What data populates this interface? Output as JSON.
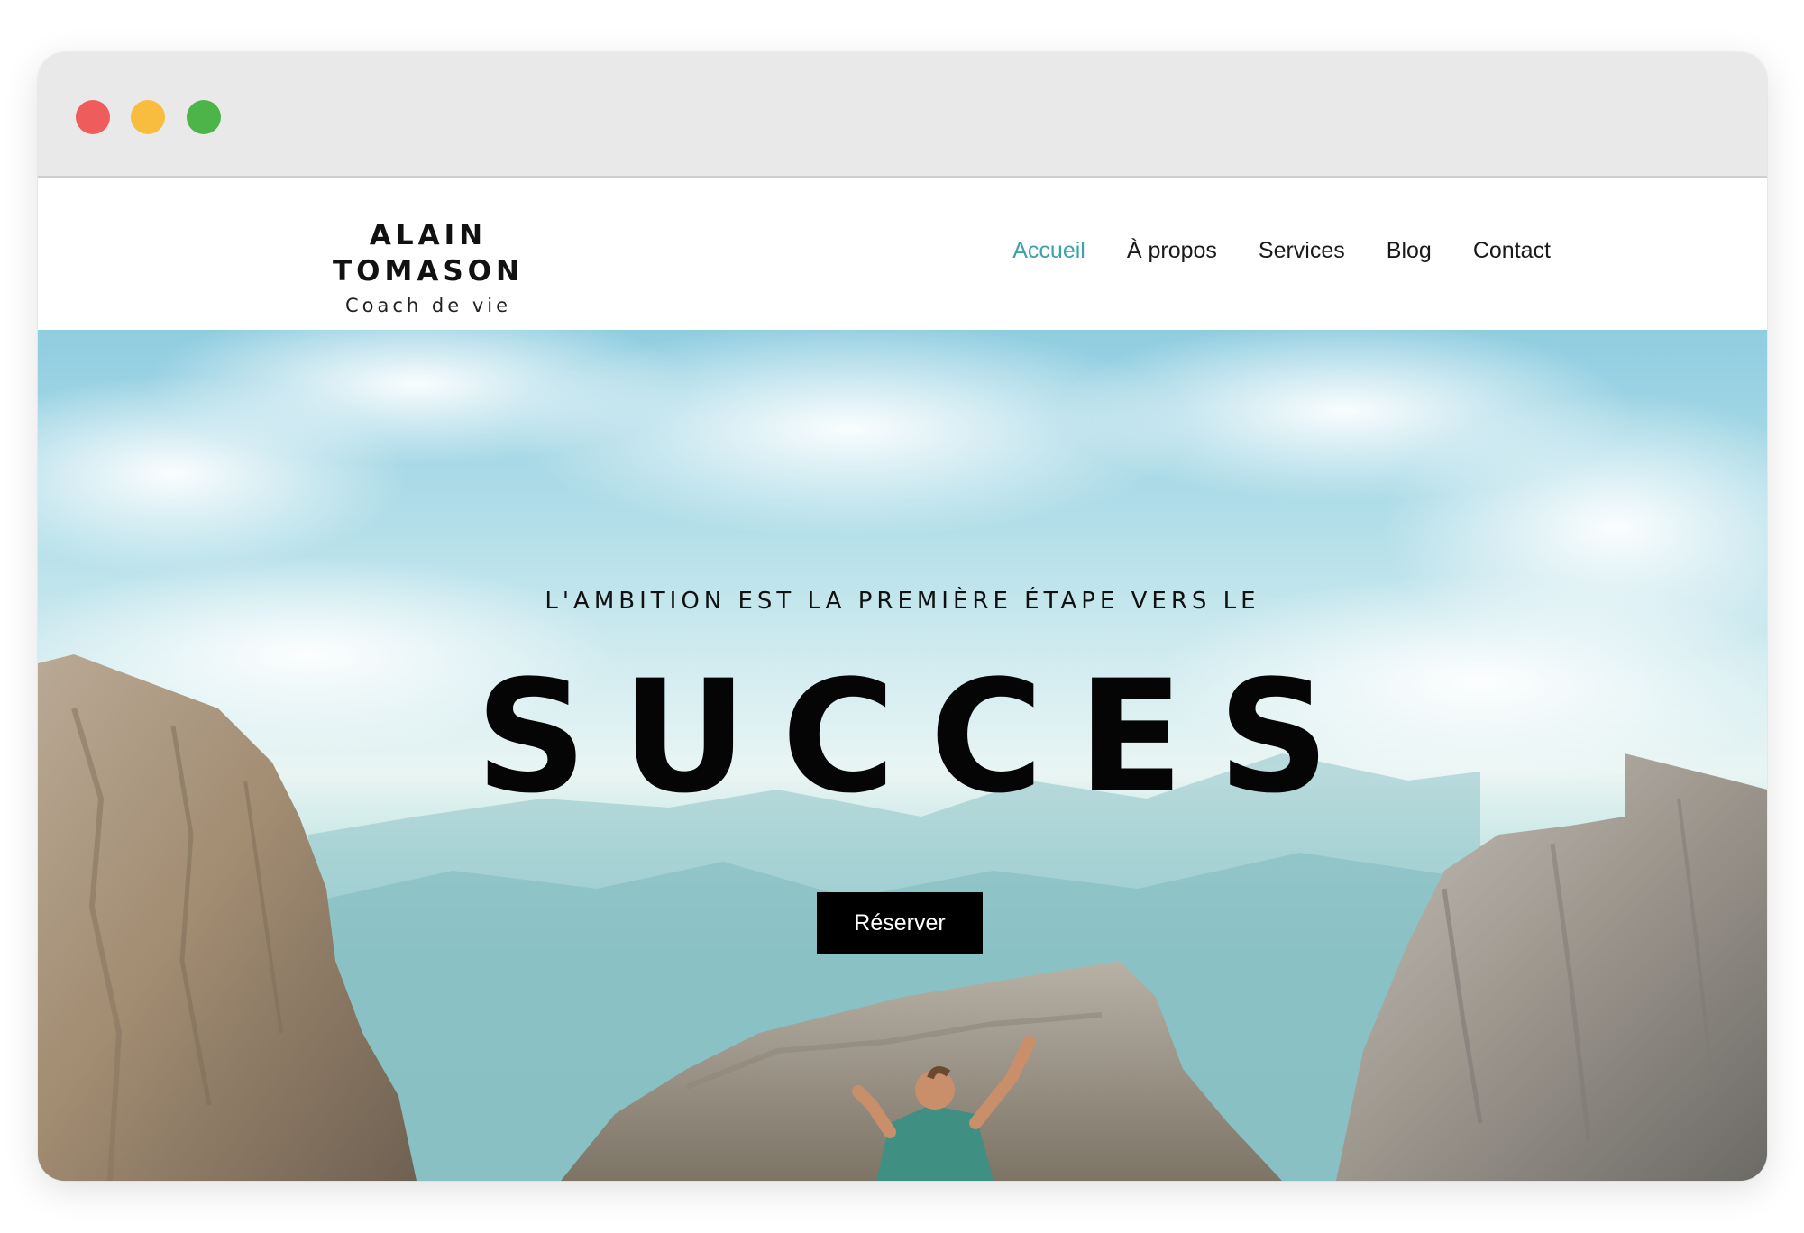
{
  "window": {
    "controls": {
      "close": "#ee5c5c",
      "minimize": "#f8bd3e",
      "maximize": "#4cb449"
    }
  },
  "header": {
    "logo_name": "ALAIN TOMASON",
    "logo_tagline": "Coach de vie",
    "nav": [
      {
        "label": "Accueil",
        "active": true
      },
      {
        "label": "À propos",
        "active": false
      },
      {
        "label": "Services",
        "active": false
      },
      {
        "label": "Blog",
        "active": false
      },
      {
        "label": "Contact",
        "active": false
      }
    ],
    "accent_color": "#3fa0ad"
  },
  "hero": {
    "kicker": "L'AMBITION EST LA PREMIÈRE ÉTAPE VERS LE",
    "title": "SUCCES",
    "cta_label": "Réserver"
  }
}
